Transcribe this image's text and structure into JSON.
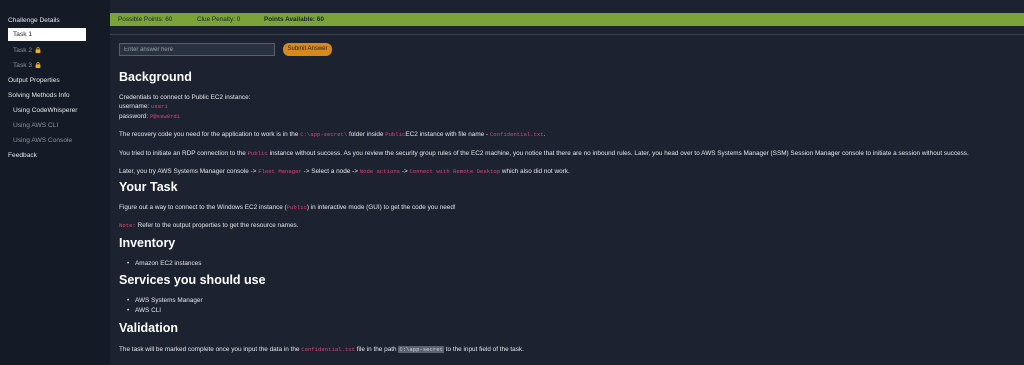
{
  "sidebar": {
    "challenge_details": "Challenge Details",
    "task1": "Task 1",
    "task2": "Task 2",
    "task3": "Task 3",
    "output_properties": "Output Properties",
    "solving_methods": "Solving Methods Info",
    "using_codewhisperer": "Using CodeWhisperer",
    "using_aws_cli": "Using AWS CLI",
    "using_aws_console": "Using AWS Console",
    "feedback": "Feedback"
  },
  "points": {
    "possible": "Possible Points: 60",
    "penalty": "Clue Penalty: 0",
    "available": "Points Available: 60"
  },
  "answer": {
    "placeholder": "Enter answer here",
    "submit": "Submit Answer"
  },
  "background": {
    "heading": "Background",
    "cred_intro": "Credentials to connect to Public EC2 instance:",
    "username_label": "username:",
    "username_value": "user1",
    "password_label": "password:",
    "password_value": "P@ssw0rd1",
    "recovery_1": "The recovery code you need for the application to work is in the",
    "recovery_path": "C:\\app-secret\\",
    "recovery_2": "folder inside",
    "recovery_public": "Public",
    "recovery_3": "EC2 instance with file name -",
    "recovery_file": "Confidential.txt",
    "recovery_4": ".",
    "rdp_1": "You tried to initiate an RDP connection to the",
    "rdp_public": "Public",
    "rdp_2": "instance without success. As you review the security group rules of the EC2 machine, you notice that there are no inbound rules. Later, you head over to AWS Systems Manager (SSM) Session Manager console to initiate a session without success.",
    "later_1": "Later, you try AWS Systems Manager console ->",
    "later_fleet": "Fleet Manager",
    "later_2": "-> Select a node ->",
    "later_node": "Node actions",
    "later_3": "->",
    "later_connect": "Connect with Remote Desktop",
    "later_4": "which also did not work."
  },
  "your_task": {
    "heading": "Your Task",
    "line_1": "Figure out a way to connect to the Windows EC2 instance (",
    "line_public": "Public",
    "line_2": ") in interactive mode (GUI) to get the code you need!",
    "note_label": "Note:",
    "note_text": "Refer to the output properties to get the resource names."
  },
  "inventory": {
    "heading": "Inventory",
    "items": [
      "Amazon EC2 instances"
    ]
  },
  "services": {
    "heading": "Services you should use",
    "items": [
      "AWS Systems Manager",
      "AWS CLI"
    ]
  },
  "validation": {
    "heading": "Validation",
    "text_1": "The task will be marked complete once you input the data in the",
    "file": "Confidential.txt",
    "text_2": "file in the path",
    "path": "C:\\app-secret",
    "text_3": "to the input field of the task."
  },
  "colors": {
    "background": "#1c2230",
    "sidebar": "#141a26",
    "points_bar": "#7aa33a",
    "submit": "#d7891c",
    "code": "#e2457a"
  }
}
